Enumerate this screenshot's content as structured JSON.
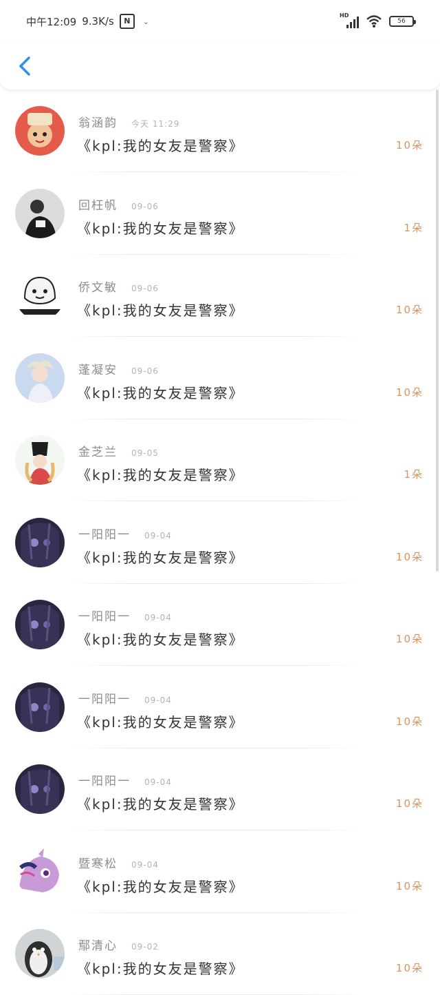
{
  "status_bar": {
    "time": "中午12:09",
    "speed": "9.3K/s",
    "battery": "56",
    "network": "HD"
  },
  "header": {
    "back_icon": "chevron-left-icon",
    "accent": "#2e8ef0"
  },
  "items": [
    {
      "name": "翁涵韵",
      "date": "今天 11:29",
      "title": "《kpl:我的女友是警察》",
      "count": "10朵",
      "avatar": "cartoon-cat-boy"
    },
    {
      "name": "回枉帆",
      "date": "09-06",
      "title": "《kpl:我的女友是警察》",
      "count": "1朵",
      "avatar": "photo-person"
    },
    {
      "name": "侨文敏",
      "date": "09-06",
      "title": "《kpl:我的女友是警察》",
      "count": "10朵",
      "avatar": "meme-sticker"
    },
    {
      "name": "蓬凝安",
      "date": "09-06",
      "title": "《kpl:我的女友是警察》",
      "count": "10朵",
      "avatar": "anime-angel"
    },
    {
      "name": "金芝兰",
      "date": "09-05",
      "title": "《kpl:我的女友是警察》",
      "count": "1朵",
      "avatar": "anime-girl-hat"
    },
    {
      "name": "一阳阳一",
      "date": "09-04",
      "title": "《kpl:我的女友是警察》",
      "count": "10朵",
      "avatar": "anime-purple"
    },
    {
      "name": "一阳阳一",
      "date": "09-04",
      "title": "《kpl:我的女友是警察》",
      "count": "10朵",
      "avatar": "anime-purple"
    },
    {
      "name": "一阳阳一",
      "date": "09-04",
      "title": "《kpl:我的女友是警察》",
      "count": "10朵",
      "avatar": "anime-purple"
    },
    {
      "name": "一阳阳一",
      "date": "09-04",
      "title": "《kpl:我的女友是警察》",
      "count": "10朵",
      "avatar": "anime-purple"
    },
    {
      "name": "暨寒松",
      "date": "09-04",
      "title": "《kpl:我的女友是警察》",
      "count": "10朵",
      "avatar": "pony-purple"
    },
    {
      "name": "鄢清心",
      "date": "09-02",
      "title": "《kpl:我的女友是警察》",
      "count": "10朵",
      "avatar": "penguin-photo"
    }
  ]
}
